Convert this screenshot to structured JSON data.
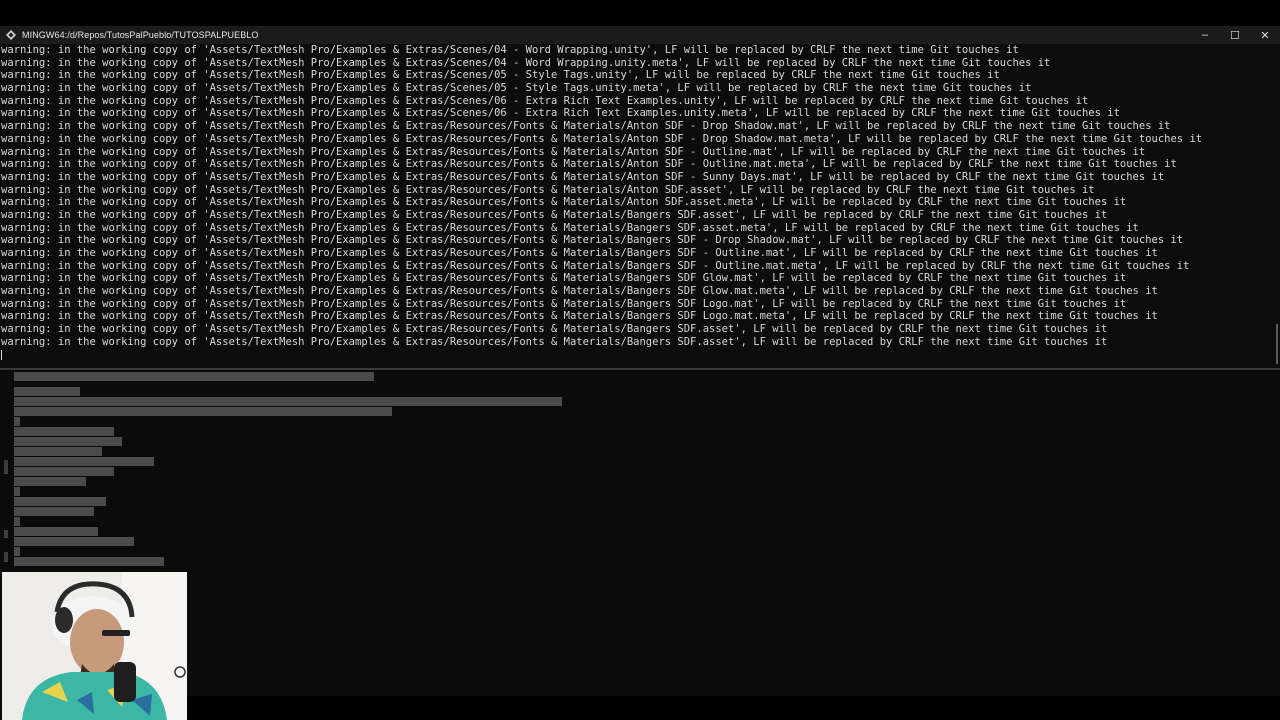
{
  "window": {
    "title": "MINGW64:/d/Repos/TutosPalPueblo/TUTOSPALPUEBLO",
    "minimize_glyph": "–",
    "maximize_glyph": "☐",
    "close_glyph": "✕"
  },
  "terminal": {
    "lines": [
      "warning: in the working copy of 'Assets/TextMesh Pro/Examples & Extras/Scenes/04 - Word Wrapping.unity', LF will be replaced by CRLF the next time Git touches it",
      "warning: in the working copy of 'Assets/TextMesh Pro/Examples & Extras/Scenes/04 - Word Wrapping.unity.meta', LF will be replaced by CRLF the next time Git touches it",
      "warning: in the working copy of 'Assets/TextMesh Pro/Examples & Extras/Scenes/05 - Style Tags.unity', LF will be replaced by CRLF the next time Git touches it",
      "warning: in the working copy of 'Assets/TextMesh Pro/Examples & Extras/Scenes/05 - Style Tags.unity.meta', LF will be replaced by CRLF the next time Git touches it",
      "warning: in the working copy of 'Assets/TextMesh Pro/Examples & Extras/Scenes/06 - Extra Rich Text Examples.unity', LF will be replaced by CRLF the next time Git touches it",
      "warning: in the working copy of 'Assets/TextMesh Pro/Examples & Extras/Scenes/06 - Extra Rich Text Examples.unity.meta', LF will be replaced by CRLF the next time Git touches it",
      "warning: in the working copy of 'Assets/TextMesh Pro/Examples & Extras/Resources/Fonts & Materials/Anton SDF - Drop Shadow.mat', LF will be replaced by CRLF the next time Git touches it",
      "warning: in the working copy of 'Assets/TextMesh Pro/Examples & Extras/Resources/Fonts & Materials/Anton SDF - Drop Shadow.mat.meta', LF will be replaced by CRLF the next time Git touches it",
      "warning: in the working copy of 'Assets/TextMesh Pro/Examples & Extras/Resources/Fonts & Materials/Anton SDF - Outline.mat', LF will be replaced by CRLF the next time Git touches it",
      "warning: in the working copy of 'Assets/TextMesh Pro/Examples & Extras/Resources/Fonts & Materials/Anton SDF - Outline.mat.meta', LF will be replaced by CRLF the next time Git touches it",
      "warning: in the working copy of 'Assets/TextMesh Pro/Examples & Extras/Resources/Fonts & Materials/Anton SDF - Sunny Days.mat', LF will be replaced by CRLF the next time Git touches it",
      "warning: in the working copy of 'Assets/TextMesh Pro/Examples & Extras/Resources/Fonts & Materials/Anton SDF.asset', LF will be replaced by CRLF the next time Git touches it",
      "warning: in the working copy of 'Assets/TextMesh Pro/Examples & Extras/Resources/Fonts & Materials/Anton SDF.asset.meta', LF will be replaced by CRLF the next time Git touches it",
      "warning: in the working copy of 'Assets/TextMesh Pro/Examples & Extras/Resources/Fonts & Materials/Bangers SDF.asset', LF will be replaced by CRLF the next time Git touches it",
      "warning: in the working copy of 'Assets/TextMesh Pro/Examples & Extras/Resources/Fonts & Materials/Bangers SDF.asset.meta', LF will be replaced by CRLF the next time Git touches it",
      "warning: in the working copy of 'Assets/TextMesh Pro/Examples & Extras/Resources/Fonts & Materials/Bangers SDF - Drop Shadow.mat', LF will be replaced by CRLF the next time Git touches it",
      "warning: in the working copy of 'Assets/TextMesh Pro/Examples & Extras/Resources/Fonts & Materials/Bangers SDF - Outline.mat', LF will be replaced by CRLF the next time Git touches it",
      "warning: in the working copy of 'Assets/TextMesh Pro/Examples & Extras/Resources/Fonts & Materials/Bangers SDF - Outline.mat.meta', LF will be replaced by CRLF the next time Git touches it",
      "warning: in the working copy of 'Assets/TextMesh Pro/Examples & Extras/Resources/Fonts & Materials/Bangers SDF Glow.mat', LF will be replaced by CRLF the next time Git touches it",
      "warning: in the working copy of 'Assets/TextMesh Pro/Examples & Extras/Resources/Fonts & Materials/Bangers SDF Glow.mat.meta', LF will be replaced by CRLF the next time Git touches it",
      "warning: in the working copy of 'Assets/TextMesh Pro/Examples & Extras/Resources/Fonts & Materials/Bangers SDF Logo.mat', LF will be replaced by CRLF the next time Git touches it",
      "warning: in the working copy of 'Assets/TextMesh Pro/Examples & Extras/Resources/Fonts & Materials/Bangers SDF Logo.mat.meta', LF will be replaced by CRLF the next time Git touches it",
      "warning: in the working copy of 'Assets/TextMesh Pro/Examples & Extras/Resources/Fonts & Materials/Bangers SDF.asset', LF will be replaced by CRLF the next time Git touches it",
      "warning: in the working copy of 'Assets/TextMesh Pro/Examples & Extras/Resources/Fonts & Materials/Bangers SDF.asset', LF will be replaced by CRLF the next time Git touches it"
    ]
  },
  "colors": {
    "terminal_bg": "#0c0c0c",
    "terminal_fg": "#d9d9d9",
    "titlebar_bg": "#1b1b1b",
    "selection": "#4b4b4b"
  },
  "icons": {
    "app": "git-bash-icon",
    "minimize": "minimize-icon",
    "maximize": "maximize-icon",
    "close": "close-icon"
  }
}
